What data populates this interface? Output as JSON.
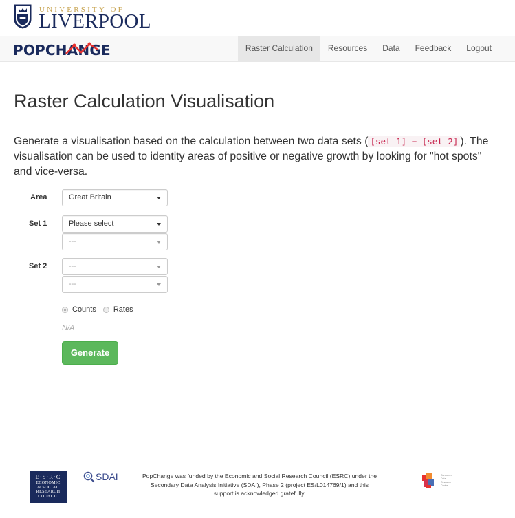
{
  "university": {
    "small_text": "UNIVERSITY OF",
    "name": "LIVERPOOL",
    "crest_icon": "university-crest-icon"
  },
  "brand": {
    "pop": "POP",
    "change": "CHANGE",
    "accent_color": "#e8322f",
    "primary_color": "#1a2a5c"
  },
  "nav": {
    "items": [
      {
        "label": "Raster Calculation",
        "active": true
      },
      {
        "label": "Resources",
        "active": false
      },
      {
        "label": "Data",
        "active": false
      },
      {
        "label": "Feedback",
        "active": false
      },
      {
        "label": "Logout",
        "active": false
      }
    ]
  },
  "page": {
    "title": "Raster Calculation Visualisation",
    "intro_before": "Generate a visualisation based on the calculation between two data sets (",
    "intro_code": "[set 1] − [set 2]",
    "intro_after": "). The visualisation can be used to identity areas of positive or negative growth by looking for \"hot spots\" and vice-versa."
  },
  "form": {
    "area_label": "Area",
    "area_value": "Great Britain",
    "set1_label": "Set 1",
    "set1_value": "Please select",
    "set1_sub_value": "---",
    "set2_label": "Set 2",
    "set2_value": "---",
    "set2_sub_value": "---",
    "radio_counts": "Counts",
    "radio_rates": "Rates",
    "selected_radio": "Counts",
    "na_text": "N/A",
    "generate_label": "Generate",
    "generate_color": "#5cb85c"
  },
  "footer": {
    "esrc_top": "E·S·R·C",
    "esrc_lines": [
      "ECONOMIC",
      "& SOCIAL",
      "RESEARCH",
      "COUNCIL"
    ],
    "sdai_text": "SDAI",
    "funding_text": "PopChange was funded by the Economic and Social Research Council (ESRC) under the Secondary Data Analysis Initiative (SDAI), Phase 2 (project ES/L014769/1) and this support is acknowledged gratefully.",
    "cdrc_lines": [
      "Consumer",
      "Data",
      "Research",
      "Centre"
    ]
  }
}
